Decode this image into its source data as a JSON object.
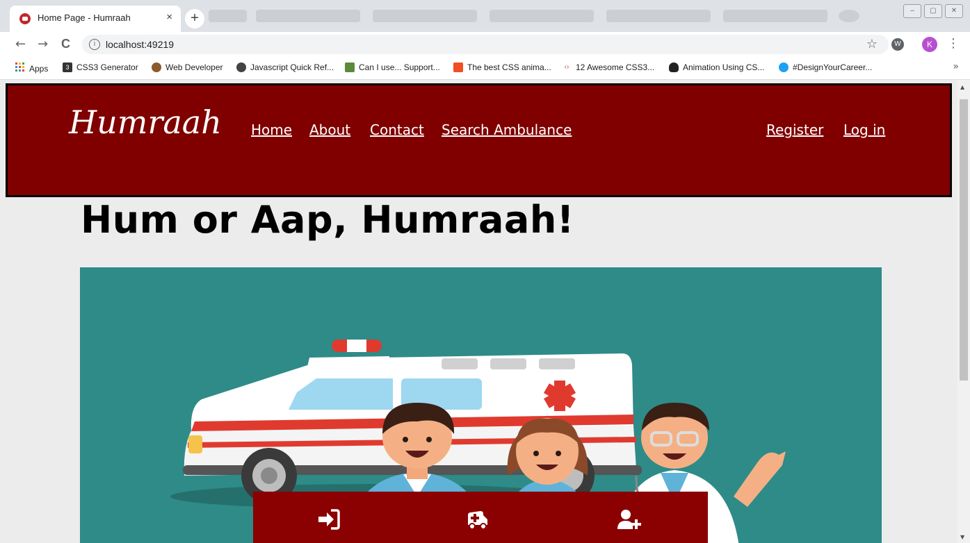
{
  "browser": {
    "active_tab": {
      "title": "Home Page - Humraah",
      "close": "×"
    },
    "new_tab": "+",
    "window_controls": [
      "–",
      "▢",
      "✕"
    ],
    "nav": {
      "back": "←",
      "forward": "→",
      "reload": "C"
    },
    "url": "localhost:49219",
    "star": "☆",
    "extension_label": "W",
    "avatar_letter": "K",
    "menu": "⋮",
    "bookmarks": [
      {
        "label": "Apps",
        "icon": "apps-grid-icon"
      },
      {
        "label": "CSS3 Generator",
        "icon": "css3-icon"
      },
      {
        "label": "Web Developer",
        "icon": "web-developer-icon"
      },
      {
        "label": "Javascript Quick Ref...",
        "icon": "globe-icon"
      },
      {
        "label": "Can I use... Support...",
        "icon": "caniuse-icon"
      },
      {
        "label": "The best CSS anima...",
        "icon": "css-anim-icon"
      },
      {
        "label": "12 Awesome CSS3...",
        "icon": "code-icon"
      },
      {
        "label": "Animation Using CS...",
        "icon": "linux-icon"
      },
      {
        "label": "#DesignYourCareer...",
        "icon": "twitter-icon"
      }
    ],
    "bookmarks_more": "»"
  },
  "site": {
    "brand": "Humraah",
    "nav": [
      "Home",
      "About",
      "Contact",
      "Search Ambulance"
    ],
    "account": [
      "Register",
      "Log in"
    ],
    "hero_title": "Hum or Aap, Humraah!",
    "colors": {
      "header": "#800000",
      "action_bar": "#8b0000",
      "hero_bg": "#2e8b88",
      "page_bg": "#ececec"
    },
    "action_icons": [
      "login-icon",
      "ambulance-medical-icon",
      "user-plus-icon"
    ]
  }
}
